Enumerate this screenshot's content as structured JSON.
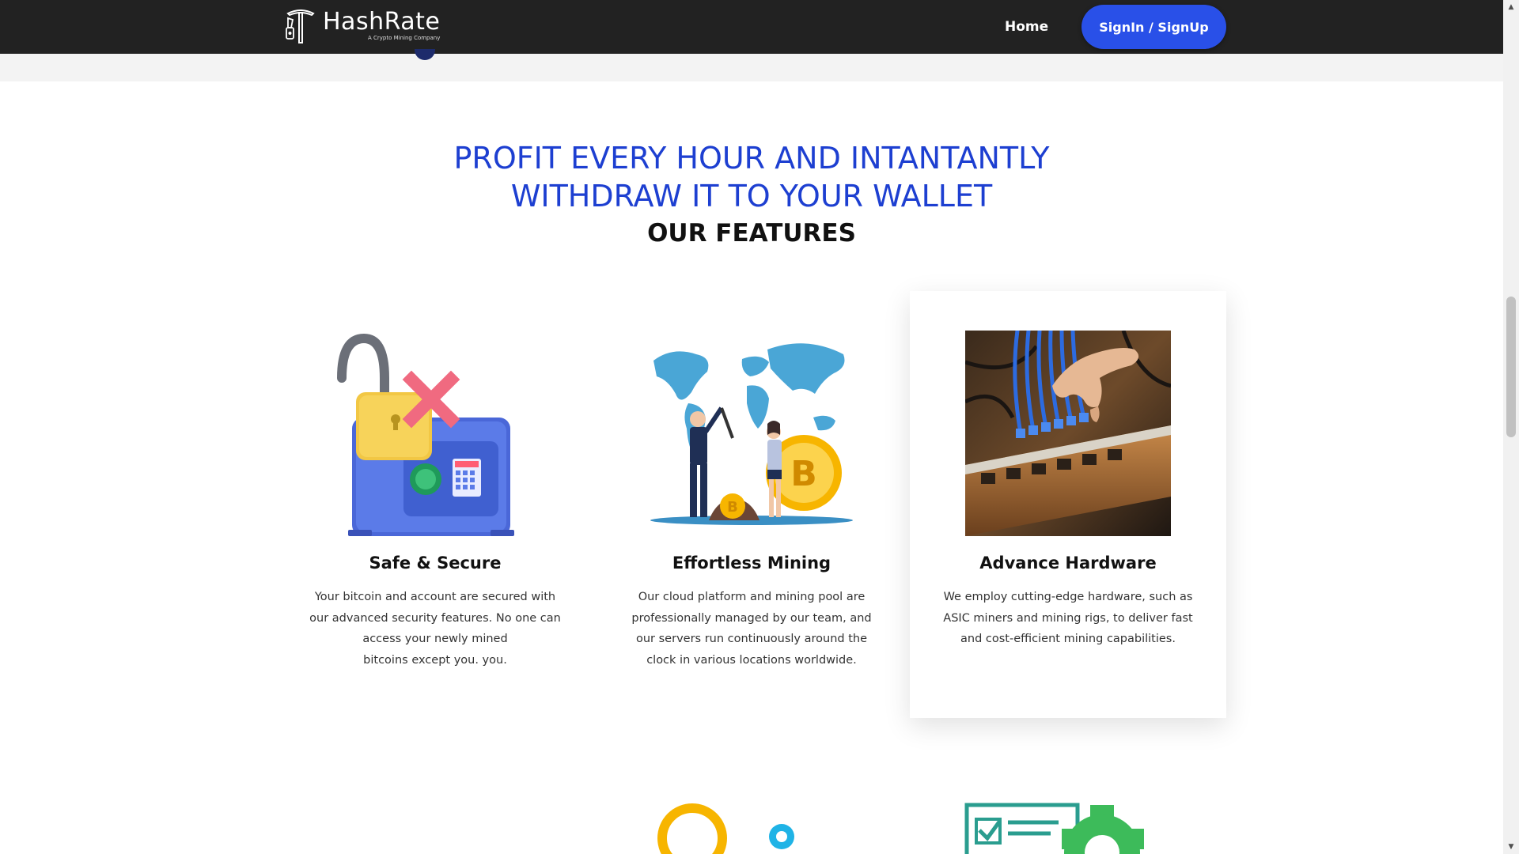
{
  "navbar": {
    "brand_name": "HashRate",
    "brand_tagline": "A Crypto Mining Company",
    "home_label": "Home",
    "signin_label": "SignIn / SignUp"
  },
  "hero": {
    "headline_line1": "PROFIT EVERY HOUR AND INTANTANTLY",
    "headline_line2": "WITHDRAW IT TO YOUR WALLET",
    "subheading": "OUR FEATURES"
  },
  "features": [
    {
      "title": "Safe & Secure",
      "icon": "safe-lock-icon",
      "lines": [
        "Your bitcoin and account are secured with",
        "our advanced security features. No one can",
        "access your newly mined",
        "bitcoins except you. you."
      ]
    },
    {
      "title": "Effortless Mining",
      "icon": "world-map-bitcoin-icon",
      "lines": [
        "Our cloud platform and mining pool are",
        "professionally managed by our team, and",
        "our servers run continuously around the",
        "clock in various locations worldwide."
      ]
    },
    {
      "title": "Advance Hardware",
      "icon": "mining-hardware-photo",
      "lines": [
        "We employ cutting-edge hardware, such as",
        "ASIC miners and mining rigs, to deliver fast",
        "and cost-efficient mining capabilities."
      ]
    }
  ],
  "colors": {
    "navbar_bg": "#222222",
    "accent_blue": "#2950e8",
    "headline_blue": "#1d3fd1",
    "card_shadow": "rgba(0,0,0,0.12)"
  },
  "scrollbar": {
    "up_icon": "▲",
    "down_icon": "▼"
  }
}
